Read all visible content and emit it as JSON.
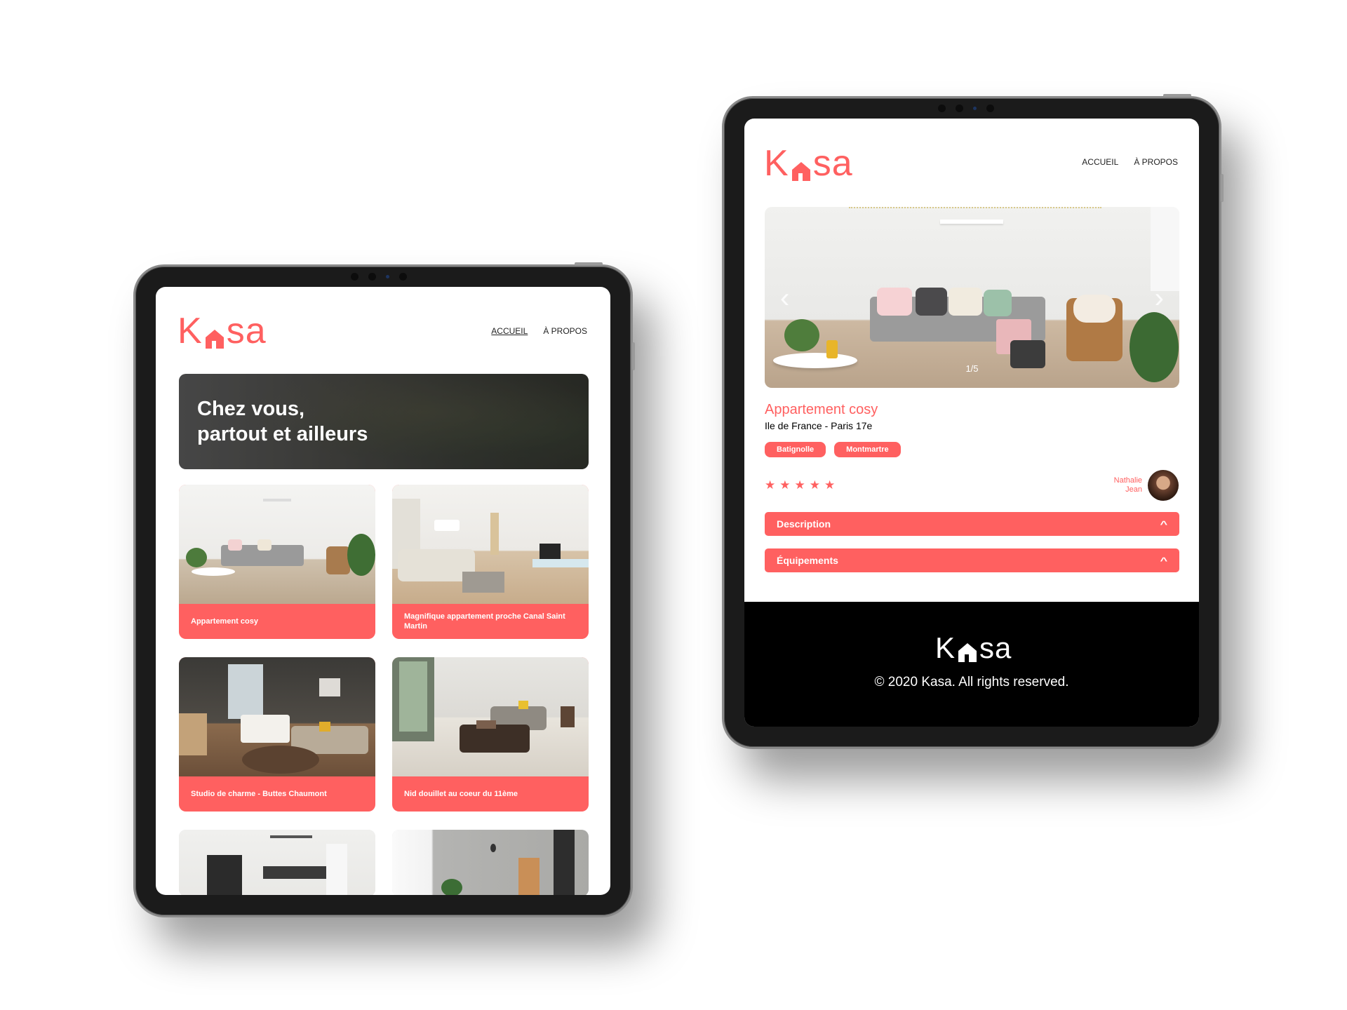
{
  "brand": {
    "name_prefix": "K",
    "name_suffix": "sa",
    "accent": "#ff6060"
  },
  "nav": {
    "home": "ACCUEIL",
    "about": "À PROPOS"
  },
  "home": {
    "banner_line1": "Chez vous,",
    "banner_line2": "partout et ailleurs",
    "cards": [
      "Appartement cosy",
      "Magnifique appartement proche Canal Saint Martin",
      "Studio de charme - Buttes Chaumont",
      "Nid douillet au coeur du 11ème"
    ]
  },
  "listing": {
    "gallery_counter": "1/5",
    "arrow_prev": "‹",
    "arrow_next": "›",
    "title": "Appartement cosy",
    "location": "Ile de France - Paris 17e",
    "tags": [
      "Batignolle",
      "Montmartre"
    ],
    "rating": 5,
    "host_first": "Nathalie",
    "host_last": "Jean",
    "sections": [
      "Description",
      "Équipements"
    ]
  },
  "footer": {
    "copyright": "© 2020 Kasa. All rights reserved."
  }
}
